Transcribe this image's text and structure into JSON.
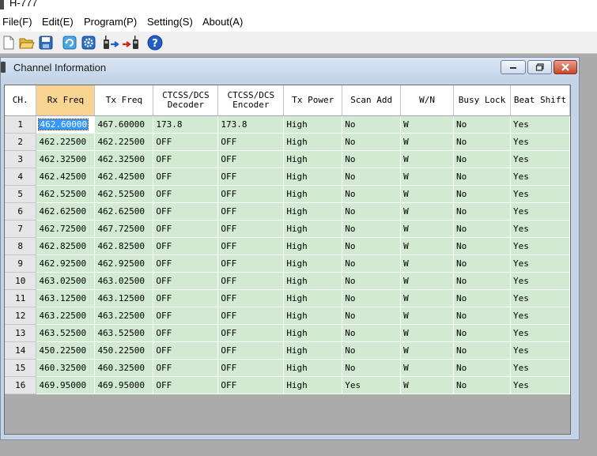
{
  "app": {
    "title": "H-777"
  },
  "menu": [
    "File(F)",
    "Edit(E)",
    "Program(P)",
    "Setting(S)",
    "About(A)"
  ],
  "toolbar": {
    "icons": [
      "new-file-icon",
      "open-folder-icon",
      "save-icon",
      "refresh-icon",
      "settings-icon",
      "read-from-radio-icon",
      "write-to-radio-icon",
      "help-icon"
    ]
  },
  "window": {
    "title": "Channel Information"
  },
  "columns": [
    "CH.",
    "Rx Freq",
    "Tx Freq",
    "CTCSS/DCS\nDecoder",
    "CTCSS/DCS\nEncoder",
    "Tx Power",
    "Scan Add",
    "W/N",
    "Busy Lock",
    "Beat Shift"
  ],
  "rows": [
    [
      "1",
      "462.60000",
      "467.60000",
      "173.8",
      "173.8",
      "High",
      "No",
      "W",
      "No",
      "Yes"
    ],
    [
      "2",
      "462.22500",
      "462.22500",
      "OFF",
      "OFF",
      "High",
      "No",
      "W",
      "No",
      "Yes"
    ],
    [
      "3",
      "462.32500",
      "462.32500",
      "OFF",
      "OFF",
      "High",
      "No",
      "W",
      "No",
      "Yes"
    ],
    [
      "4",
      "462.42500",
      "462.42500",
      "OFF",
      "OFF",
      "High",
      "No",
      "W",
      "No",
      "Yes"
    ],
    [
      "5",
      "462.52500",
      "462.52500",
      "OFF",
      "OFF",
      "High",
      "No",
      "W",
      "No",
      "Yes"
    ],
    [
      "6",
      "462.62500",
      "462.62500",
      "OFF",
      "OFF",
      "High",
      "No",
      "W",
      "No",
      "Yes"
    ],
    [
      "7",
      "462.72500",
      "467.72500",
      "OFF",
      "OFF",
      "High",
      "No",
      "W",
      "No",
      "Yes"
    ],
    [
      "8",
      "462.82500",
      "462.82500",
      "OFF",
      "OFF",
      "High",
      "No",
      "W",
      "No",
      "Yes"
    ],
    [
      "9",
      "462.92500",
      "462.92500",
      "OFF",
      "OFF",
      "High",
      "No",
      "W",
      "No",
      "Yes"
    ],
    [
      "10",
      "463.02500",
      "463.02500",
      "OFF",
      "OFF",
      "High",
      "No",
      "W",
      "No",
      "Yes"
    ],
    [
      "11",
      "463.12500",
      "463.12500",
      "OFF",
      "OFF",
      "High",
      "No",
      "W",
      "No",
      "Yes"
    ],
    [
      "12",
      "463.22500",
      "463.22500",
      "OFF",
      "OFF",
      "High",
      "No",
      "W",
      "No",
      "Yes"
    ],
    [
      "13",
      "463.52500",
      "463.52500",
      "OFF",
      "OFF",
      "High",
      "No",
      "W",
      "No",
      "Yes"
    ],
    [
      "14",
      "450.22500",
      "450.22500",
      "OFF",
      "OFF",
      "High",
      "No",
      "W",
      "No",
      "Yes"
    ],
    [
      "15",
      "460.32500",
      "460.32500",
      "OFF",
      "OFF",
      "High",
      "No",
      "W",
      "No",
      "Yes"
    ],
    [
      "16",
      "469.95000",
      "469.95000",
      "OFF",
      "OFF",
      "High",
      "Yes",
      "W",
      "No",
      "Yes"
    ]
  ],
  "colors": {
    "row_bg": "#d2e9d2",
    "header_active": "#f8d493",
    "selection": "#3399ff",
    "workspace": "#ababab"
  }
}
